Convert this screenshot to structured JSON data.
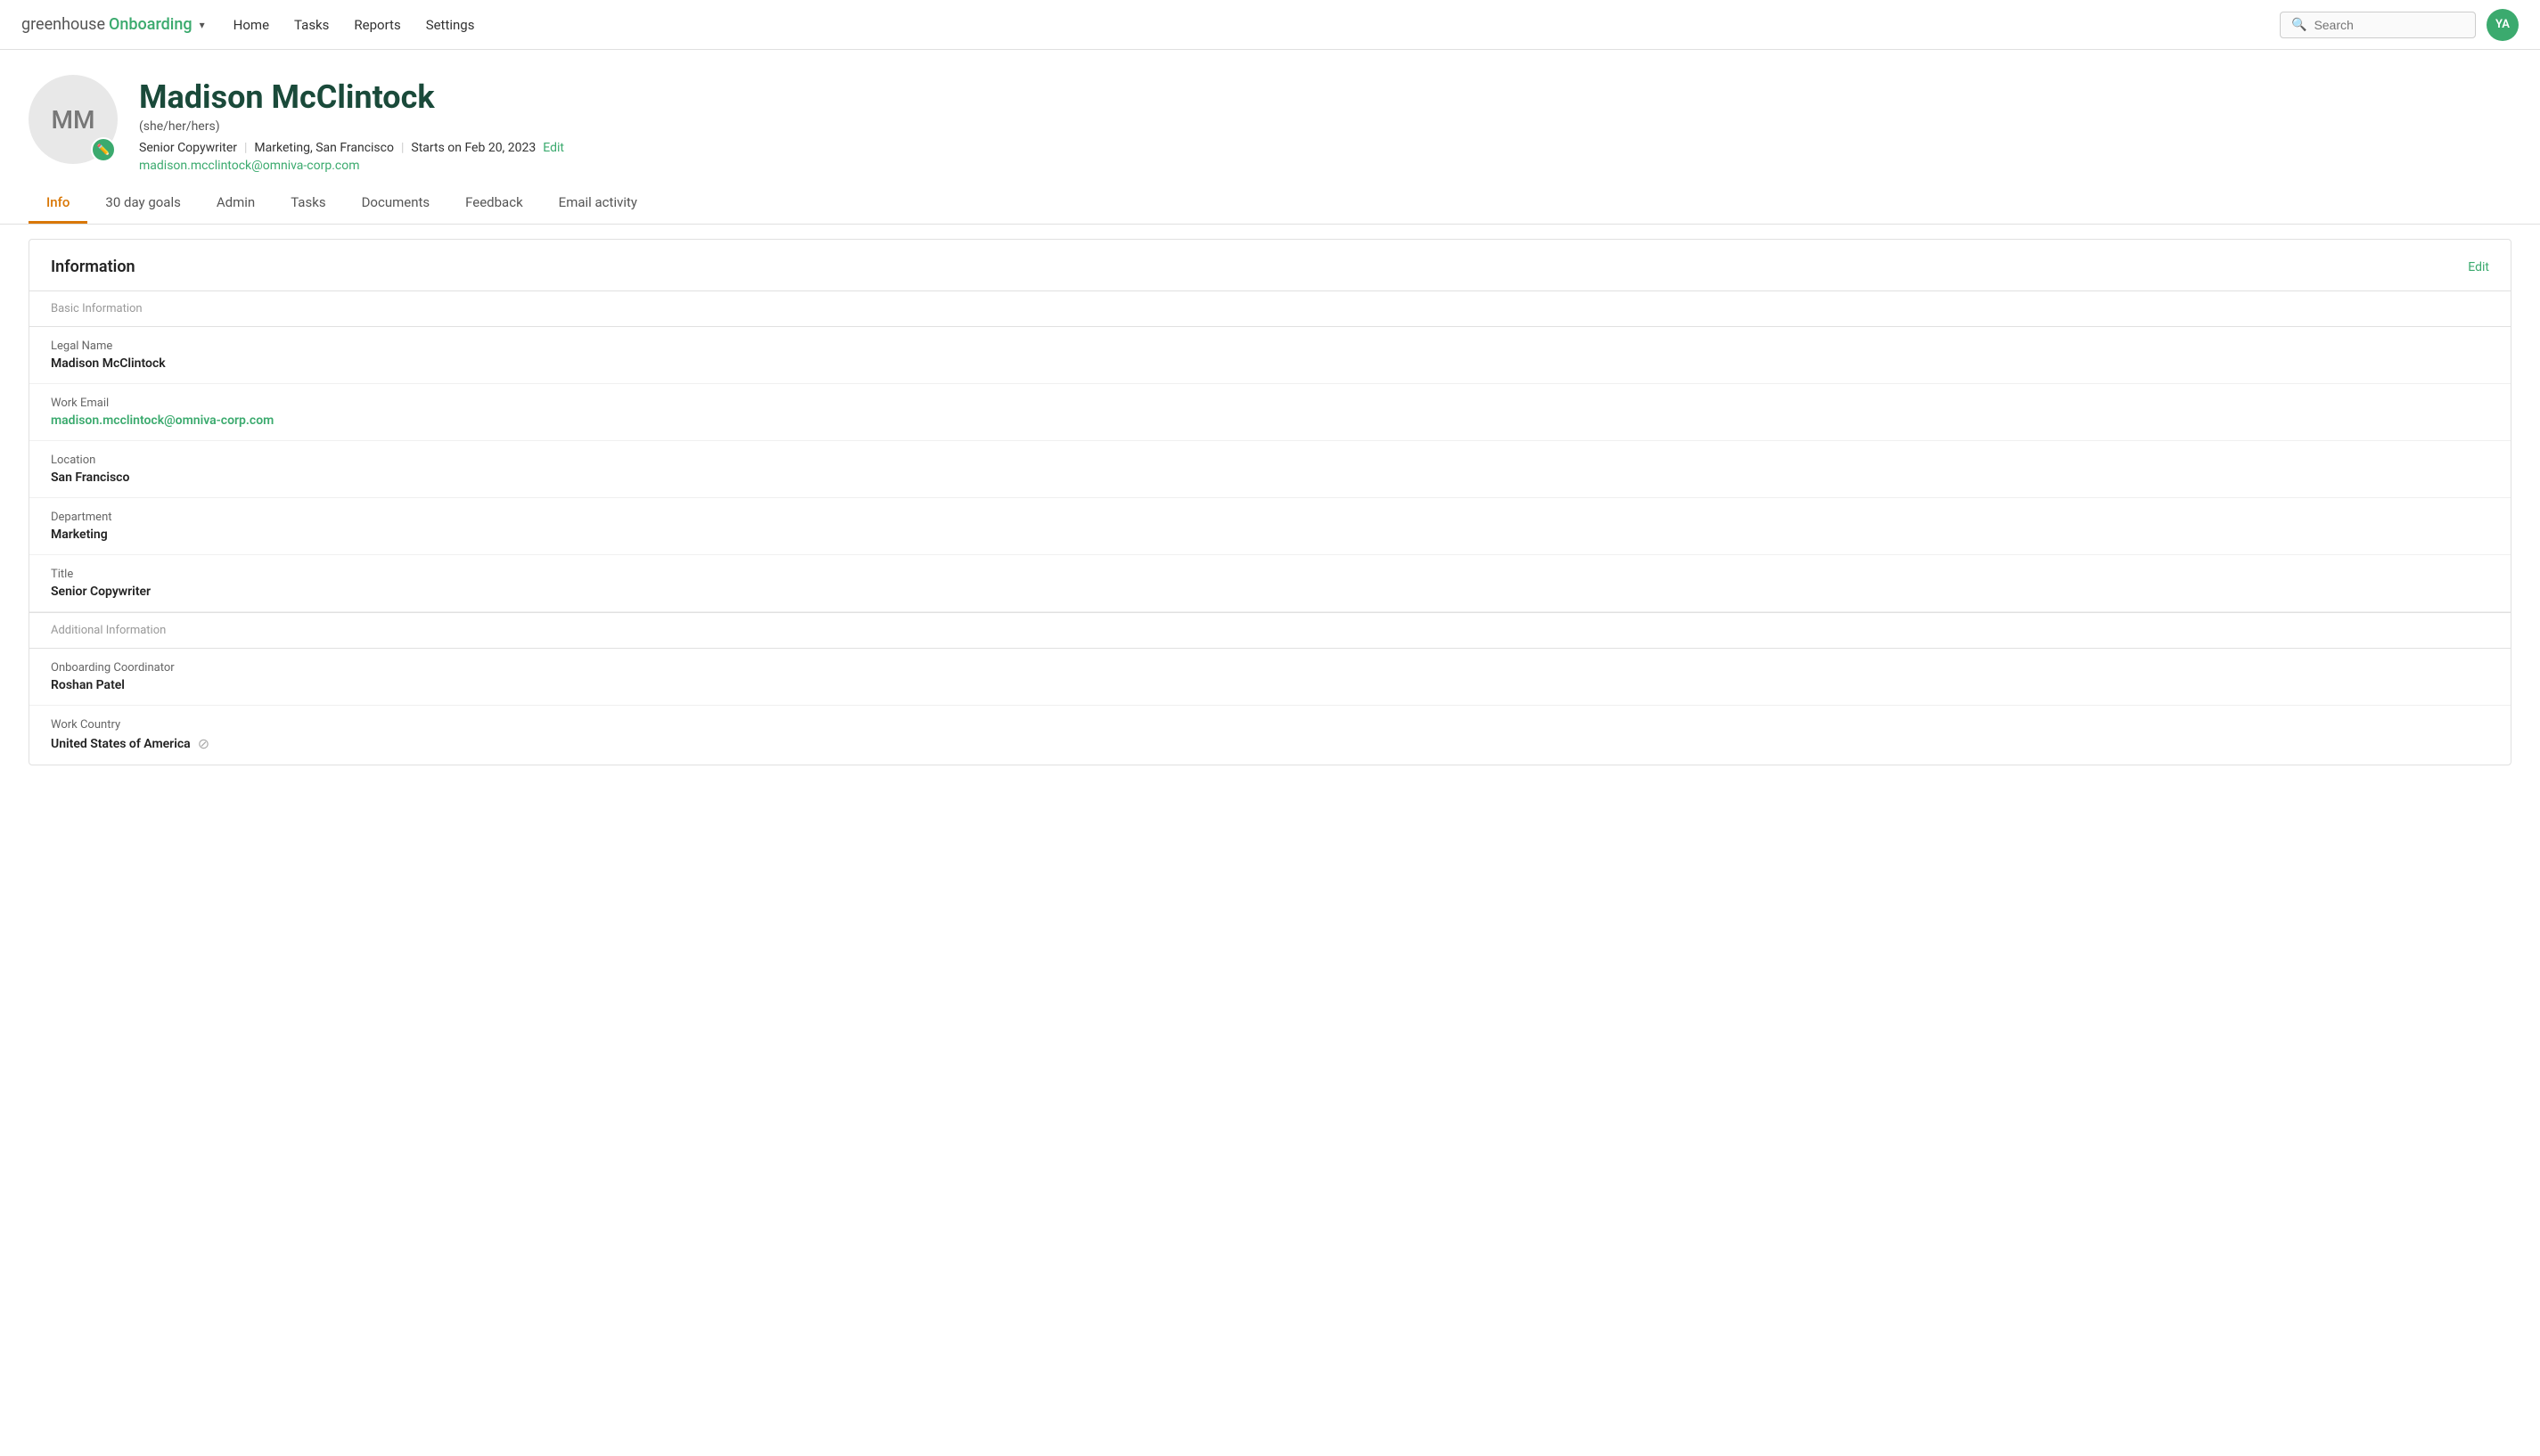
{
  "app": {
    "brand_main": "greenhouse",
    "brand_sub": "Onboarding",
    "brand_caret": "▾"
  },
  "nav": {
    "links": [
      {
        "label": "Home",
        "href": "#"
      },
      {
        "label": "Tasks",
        "href": "#"
      },
      {
        "label": "Reports",
        "href": "#"
      },
      {
        "label": "Settings",
        "href": "#"
      }
    ],
    "search_placeholder": "Search",
    "user_initials": "YA"
  },
  "profile": {
    "initials": "MM",
    "name": "Madison McClintock",
    "pronouns": "(she/her/hers)",
    "title": "Senior Copywriter",
    "department": "Marketing",
    "location": "San Francisco",
    "start_date": "Starts on Feb 20, 2023",
    "edit_label": "Edit",
    "email": "madison.mcclintock@omniva-corp.com"
  },
  "tabs": [
    {
      "label": "Info",
      "active": true
    },
    {
      "label": "30 day goals",
      "active": false
    },
    {
      "label": "Admin",
      "active": false
    },
    {
      "label": "Tasks",
      "active": false
    },
    {
      "label": "Documents",
      "active": false
    },
    {
      "label": "Feedback",
      "active": false
    },
    {
      "label": "Email activity",
      "active": false
    }
  ],
  "information": {
    "section_title": "Information",
    "edit_label": "Edit",
    "basic_info_header": "Basic Information",
    "fields_basic": [
      {
        "label": "Legal Name",
        "value": "Madison McClintock",
        "link": false
      },
      {
        "label": "Work Email",
        "value": "madison.mcclintock@omniva-corp.com",
        "link": true
      },
      {
        "label": "Location",
        "value": "San Francisco",
        "link": false
      },
      {
        "label": "Department",
        "value": "Marketing",
        "link": false
      },
      {
        "label": "Title",
        "value": "Senior Copywriter",
        "link": false
      }
    ],
    "additional_info_header": "Additional Information",
    "fields_additional": [
      {
        "label": "Onboarding Coordinator",
        "value": "Roshan Patel",
        "link": false
      },
      {
        "label": "Work Country",
        "value": "United States of America",
        "link": false,
        "has_icon": true
      }
    ]
  }
}
